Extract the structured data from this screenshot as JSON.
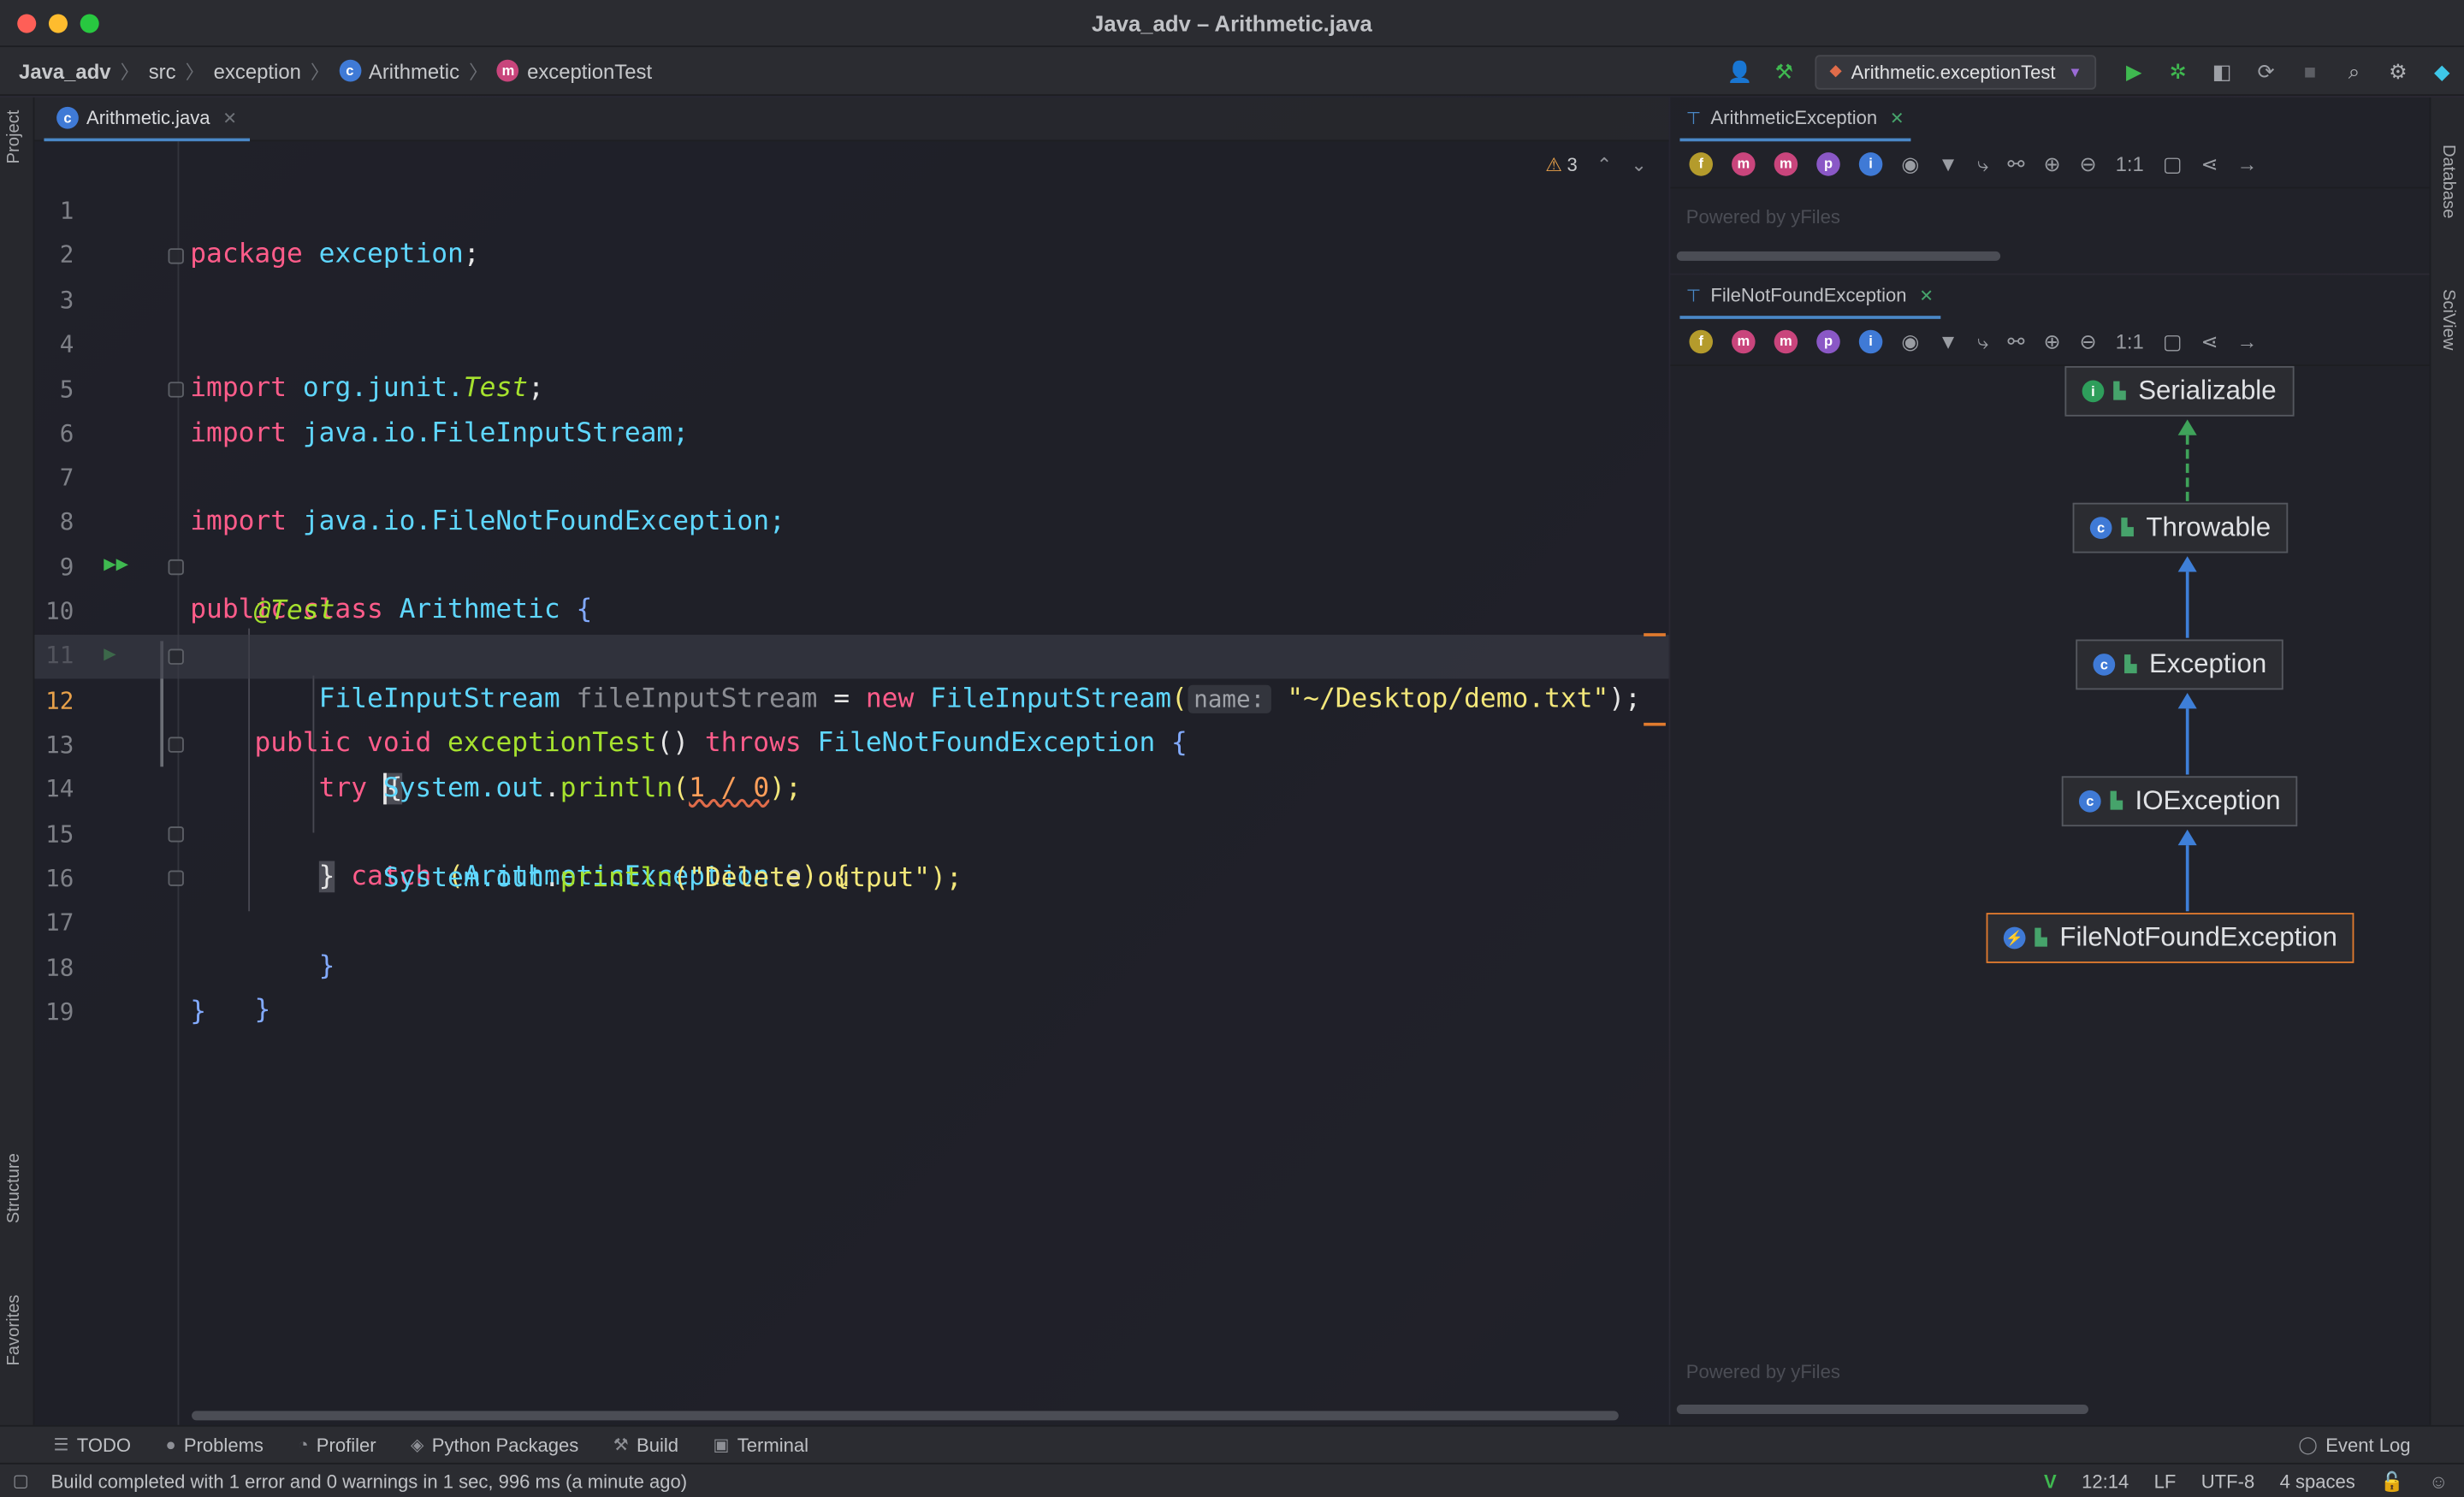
{
  "window": {
    "title": "Java_adv – Arithmetic.java"
  },
  "breadcrumb": {
    "project": "Java_adv",
    "src": "src",
    "package": "exception",
    "class": "Arithmetic",
    "method": "exceptionTest"
  },
  "toolbar": {
    "run_config": "Arithmetic.exceptionTest"
  },
  "left_strip": {
    "project": "Project",
    "structure": "Structure",
    "favorites": "Favorites"
  },
  "right_strip": {
    "database": "Database",
    "sciview": "SciView"
  },
  "editor": {
    "tab": "Arithmetic.java",
    "warnings": "3",
    "line_numbers": [
      "1",
      "2",
      "3",
      "4",
      "5",
      "6",
      "7",
      "8",
      "9",
      "10",
      "11",
      "12",
      "13",
      "14",
      "15",
      "16",
      "17",
      "18",
      "19"
    ],
    "current_line": "12",
    "tokens": {
      "l1": [
        "package",
        " exception",
        ";"
      ],
      "l3": [
        "import",
        " org.junit.",
        "Test",
        ";"
      ],
      "l5": [
        "import",
        " java.io.FileInputStream;"
      ],
      "l6": [
        "import",
        " java.io.FileNotFoundException;"
      ],
      "l8": [
        "public class ",
        "Arithmetic",
        " {"
      ],
      "l9": [
        "@Test"
      ],
      "l10": [
        "public void ",
        "exceptionTest",
        "() ",
        "throws ",
        "FileNotFoundException",
        " {"
      ],
      "l11": [
        "FileInputStream",
        " fileInputStream",
        " = ",
        "new ",
        "FileInputStream",
        "(",
        "name:",
        "\"~/Desktop/demo.txt\"",
        ");"
      ],
      "l12": [
        "try",
        " ",
        "{"
      ],
      "l13": [
        "System.",
        "out",
        ".",
        "println",
        "(",
        "1 / 0",
        ");"
      ],
      "l14": [
        "}",
        " catch ",
        "(",
        "ArithmeticException",
        " e",
        ") {"
      ],
      "l15": [
        "System.",
        "out",
        ".",
        "println",
        "(",
        "\"Delete output\"",
        ");"
      ],
      "l16": [
        "}"
      ],
      "l17": [
        "}"
      ],
      "l18": [
        "}"
      ]
    }
  },
  "panels": {
    "top_tab": "ArithmeticException",
    "bottom_tab": "FileNotFoundException",
    "powered": "Powered by yFiles",
    "nodes": [
      "Serializable",
      "Throwable",
      "Exception",
      "IOException",
      "FileNotFoundException"
    ]
  },
  "bottom_tools": [
    "TODO",
    "Problems",
    "Profiler",
    "Python Packages",
    "Build",
    "Terminal"
  ],
  "event_log": "Event Log",
  "status": {
    "message": "Build completed with 1 error and 0 warnings in 1 sec, 996 ms (a minute ago)",
    "position": "12:14",
    "line_sep": "LF",
    "encoding": "UTF-8",
    "indent": "4 spaces"
  },
  "colors": {
    "accent": "#4a88c7",
    "selected_node": "#e07a2e",
    "run": "#3fb950"
  }
}
